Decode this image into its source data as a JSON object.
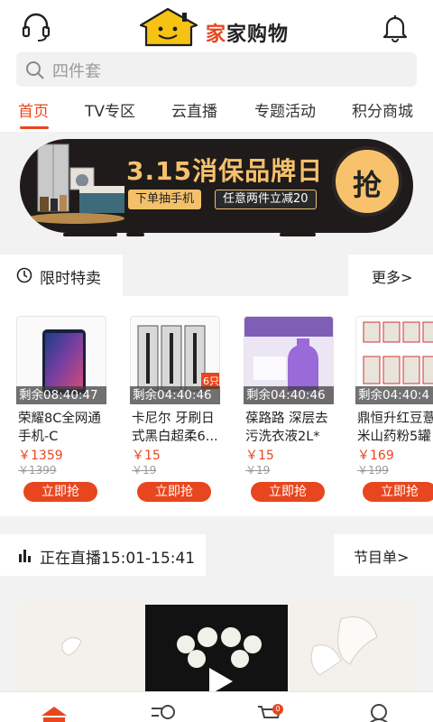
{
  "header": {
    "logo_brand_prefix": "家",
    "logo_brand_rest": "家购物",
    "service_icon": "headset-icon",
    "notification_icon": "bell-icon"
  },
  "search": {
    "placeholder": "四件套",
    "icon": "search-icon"
  },
  "tabs": [
    {
      "label": "首页",
      "active": true
    },
    {
      "label": "TV专区",
      "active": false
    },
    {
      "label": "云直播",
      "active": false
    },
    {
      "label": "专题活动",
      "active": false
    },
    {
      "label": "积分商城",
      "active": false
    }
  ],
  "banner": {
    "title": "3.15消保品牌日",
    "pill1": "下单抽手机",
    "pill2": "任意两件立减20",
    "cta": "抢"
  },
  "flash_sale": {
    "icon": "clock-icon",
    "title": "限时特卖",
    "more": "更多>",
    "products": [
      {
        "timer": "剩余08:40:47",
        "name": "荣耀8C全网通手机-C",
        "price": "￥1359",
        "original": "￥1399",
        "button": "立即抢"
      },
      {
        "timer": "剩余04:40:46",
        "name": "卡尼尔 牙刷日式黑白超柔6...",
        "price": "￥15",
        "original": "￥19",
        "button": "立即抢",
        "tag": "6只"
      },
      {
        "timer": "剩余04:40:46",
        "name": "葆路路 深层去污洗衣液2L*",
        "price": "￥15",
        "original": "￥19",
        "button": "立即抢"
      },
      {
        "timer": "剩余04:40:4",
        "name": "鼎恒升红豆薏米山药粉5罐",
        "price": "￥169",
        "original": "￥199",
        "button": "立即抢"
      }
    ]
  },
  "live": {
    "icon": "bar-chart-icon",
    "title": "正在直播15:01-15:41",
    "schedule": "节目单>"
  },
  "bottom_nav": {
    "home_icon": "home-icon",
    "category_icon": "category-search-icon",
    "cart_icon": "cart-icon",
    "cart_count": "0",
    "profile_icon": "user-icon"
  },
  "colors": {
    "accent": "#e8461e",
    "banner_bg": "#1e1b1a",
    "banner_gold": "#f7c16c"
  }
}
